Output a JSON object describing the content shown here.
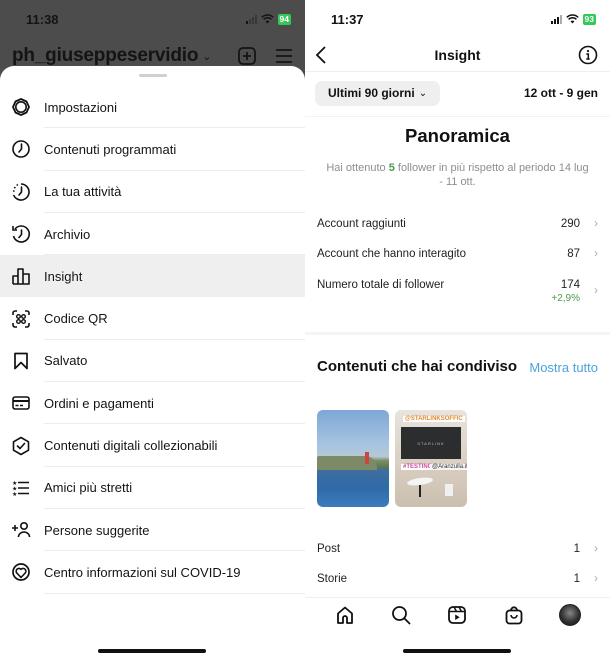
{
  "left": {
    "status": {
      "time": "11:38",
      "battery": "94"
    },
    "account": {
      "username": "ph_giuseppeservidio",
      "chevron_icon": "chevron-down-icon",
      "new_post_icon": "plus-square-icon",
      "menu_icon": "hamburger-menu-icon"
    },
    "menu": [
      {
        "label": "Impostazioni",
        "icon": "settings-gear-icon",
        "active": false
      },
      {
        "label": "Contenuti programmati",
        "icon": "clock-icon",
        "active": false
      },
      {
        "label": "La tua attività",
        "icon": "activity-clock-icon",
        "active": false
      },
      {
        "label": "Archivio",
        "icon": "archive-history-icon",
        "active": false
      },
      {
        "label": "Insight",
        "icon": "bar-chart-icon",
        "active": true
      },
      {
        "label": "Codice QR",
        "icon": "qr-code-icon",
        "active": false
      },
      {
        "label": "Salvato",
        "icon": "bookmark-icon",
        "active": false
      },
      {
        "label": "Ordini e pagamenti",
        "icon": "credit-card-icon",
        "active": false
      },
      {
        "label": "Contenuti digitali collezionabili",
        "icon": "verified-check-icon",
        "active": false
      },
      {
        "label": "Amici più stretti",
        "icon": "close-friends-list-icon",
        "active": false
      },
      {
        "label": "Persone suggerite",
        "icon": "add-person-icon",
        "active": false
      },
      {
        "label": "Centro informazioni sul COVID-19",
        "icon": "covid-heart-icon",
        "active": false
      }
    ]
  },
  "right": {
    "status": {
      "time": "11:37",
      "battery": "93"
    },
    "nav": {
      "title": "Insight",
      "back_icon": "back-chevron-icon",
      "info_icon": "info-icon"
    },
    "filter": {
      "period_label": "Ultimi 90 giorni",
      "date_range": "12 ott - 9 gen"
    },
    "overview": {
      "title": "Panoramica",
      "sub_prefix": "Hai ottenuto ",
      "sub_highlight": "5",
      "sub_suffix": " follower in più rispetto al periodo 14 lug - 11 ott."
    },
    "stats": [
      {
        "label": "Account raggiunti",
        "value": "290",
        "delta": ""
      },
      {
        "label": "Account che hanno interagito",
        "value": "87",
        "delta": ""
      },
      {
        "label": "Numero totale di follower",
        "value": "174",
        "delta": "+2,9%"
      }
    ],
    "shared": {
      "title": "Contenuti che hai condiviso",
      "show_all": "Mostra tutto",
      "thumbs": [
        {
          "kind": "post",
          "description": "Lighthouse on a rocky cliff by the sea"
        },
        {
          "kind": "story",
          "tag1": "@STARLINKSOFFIC",
          "screen_text": "STARLINK",
          "tag2": "#TESTING",
          "tag3": "@Aranzulla.it"
        }
      ]
    },
    "counts": [
      {
        "label": "Post",
        "value": "1"
      },
      {
        "label": "Storie",
        "value": "1"
      }
    ],
    "tabbar": [
      {
        "name": "home",
        "icon": "home-icon"
      },
      {
        "name": "search",
        "icon": "search-icon"
      },
      {
        "name": "reels",
        "icon": "reels-icon"
      },
      {
        "name": "shop",
        "icon": "shopping-bag-icon"
      },
      {
        "name": "profile",
        "icon": "profile-avatar-icon"
      }
    ]
  }
}
